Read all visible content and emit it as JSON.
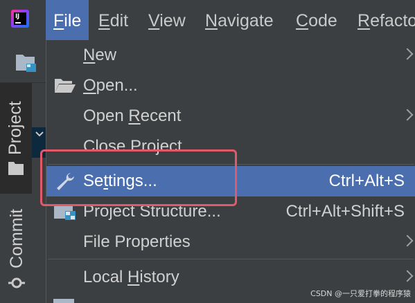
{
  "menubar": {
    "items": [
      {
        "prefix": "",
        "mnemonic": "F",
        "suffix": "ile"
      },
      {
        "prefix": "",
        "mnemonic": "E",
        "suffix": "dit"
      },
      {
        "prefix": "",
        "mnemonic": "V",
        "suffix": "iew"
      },
      {
        "prefix": "",
        "mnemonic": "N",
        "suffix": "avigate"
      },
      {
        "prefix": "",
        "mnemonic": "C",
        "suffix": "ode"
      },
      {
        "prefix": "",
        "mnemonic": "R",
        "suffix": "efacto"
      }
    ]
  },
  "sidebar": {
    "project_tab": "Project",
    "commit_tab": "Commit"
  },
  "file_menu": {
    "new": {
      "mnemonic": "N",
      "rest": "ew"
    },
    "open": {
      "mnemonic": "O",
      "rest": "pen..."
    },
    "open_recent": {
      "prefix": "Open ",
      "mnemonic": "R",
      "rest": "ecent"
    },
    "close_project": "Close Project",
    "settings": {
      "prefix": "Se",
      "mnemonic": "t",
      "rest": "tings...",
      "shortcut": "Ctrl+Alt+S"
    },
    "project_structure": {
      "label": "Project Structure...",
      "shortcut": "Ctrl+Alt+Shift+S"
    },
    "file_properties": "File Properties",
    "local_history": {
      "prefix": "Local ",
      "mnemonic": "H",
      "rest": "istory"
    }
  },
  "watermark": "CSDN @一只爱打拳的程序猿",
  "colors": {
    "menu_background": "#3c3f41",
    "selection": "#4b6eaf",
    "highlight_border": "#e05a6a"
  }
}
